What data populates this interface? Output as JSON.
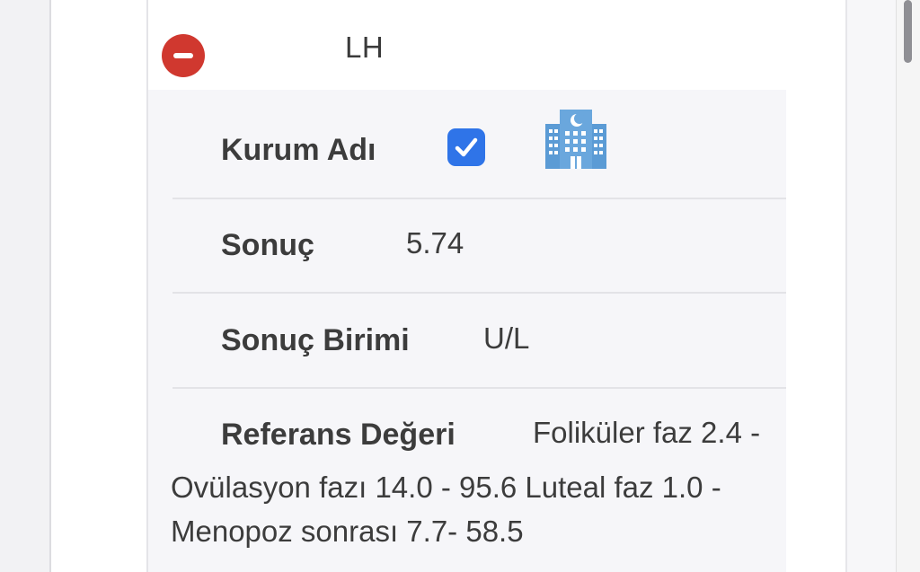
{
  "test": {
    "name": "LH"
  },
  "fields": {
    "kurum_label": "Kurum Adı",
    "kurum_checked": true,
    "sonuc_label": "Sonuç",
    "sonuc_value": "5.74",
    "birim_label": "Sonuç Birimi",
    "birim_value": "U/L",
    "referans_label": "Referans Değeri",
    "referans_line1": "Foliküler faz 2.4 -",
    "referans_line2": "Ovülasyon fazı 14.0 - 95.6 Luteal faz 1.0 -",
    "referans_line3": "Menopoz sonrası 7.7- 58.5"
  },
  "icons": {
    "remove": "minus-circle-icon",
    "checkbox": "checkmark-icon",
    "institution": "hospital-building-icon"
  },
  "colors": {
    "remove_red": "#d0382f",
    "checkbox_blue": "#2f74e8",
    "hospital_blue": "#5b9bd5"
  }
}
